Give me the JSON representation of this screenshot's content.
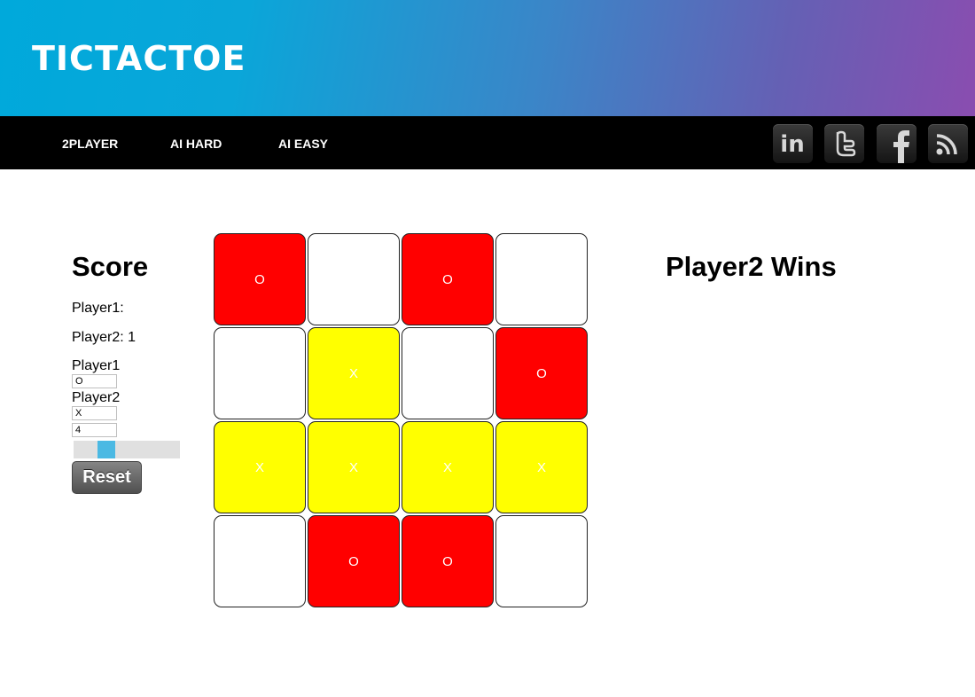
{
  "app": {
    "title": "TICTACTOE"
  },
  "nav": {
    "items": [
      "2PLAYER",
      "AI HARD",
      "AI EASY"
    ]
  },
  "social": [
    "linkedin-icon",
    "twitter-icon",
    "facebook-icon",
    "rss-icon"
  ],
  "score": {
    "title": "Score",
    "player1": "Player1:",
    "player2": "Player2: 1"
  },
  "settings": {
    "player1_label": "Player1",
    "player1_symbol": "O",
    "player2_label": "Player2",
    "player2_symbol": "X",
    "board_size": "4",
    "slider_fraction": 0.27,
    "reset_label": "Reset"
  },
  "board": {
    "size": 4,
    "cells": [
      [
        "O",
        "",
        "O",
        ""
      ],
      [
        "",
        "X",
        "",
        "O"
      ],
      [
        "X",
        "X",
        "X",
        "X"
      ],
      [
        "",
        "O",
        "O",
        ""
      ]
    ]
  },
  "colors": {
    "O": "#ff0000",
    "X": "#ffff00",
    "empty": "#ffffff"
  },
  "result": {
    "text": "Player2 Wins"
  }
}
